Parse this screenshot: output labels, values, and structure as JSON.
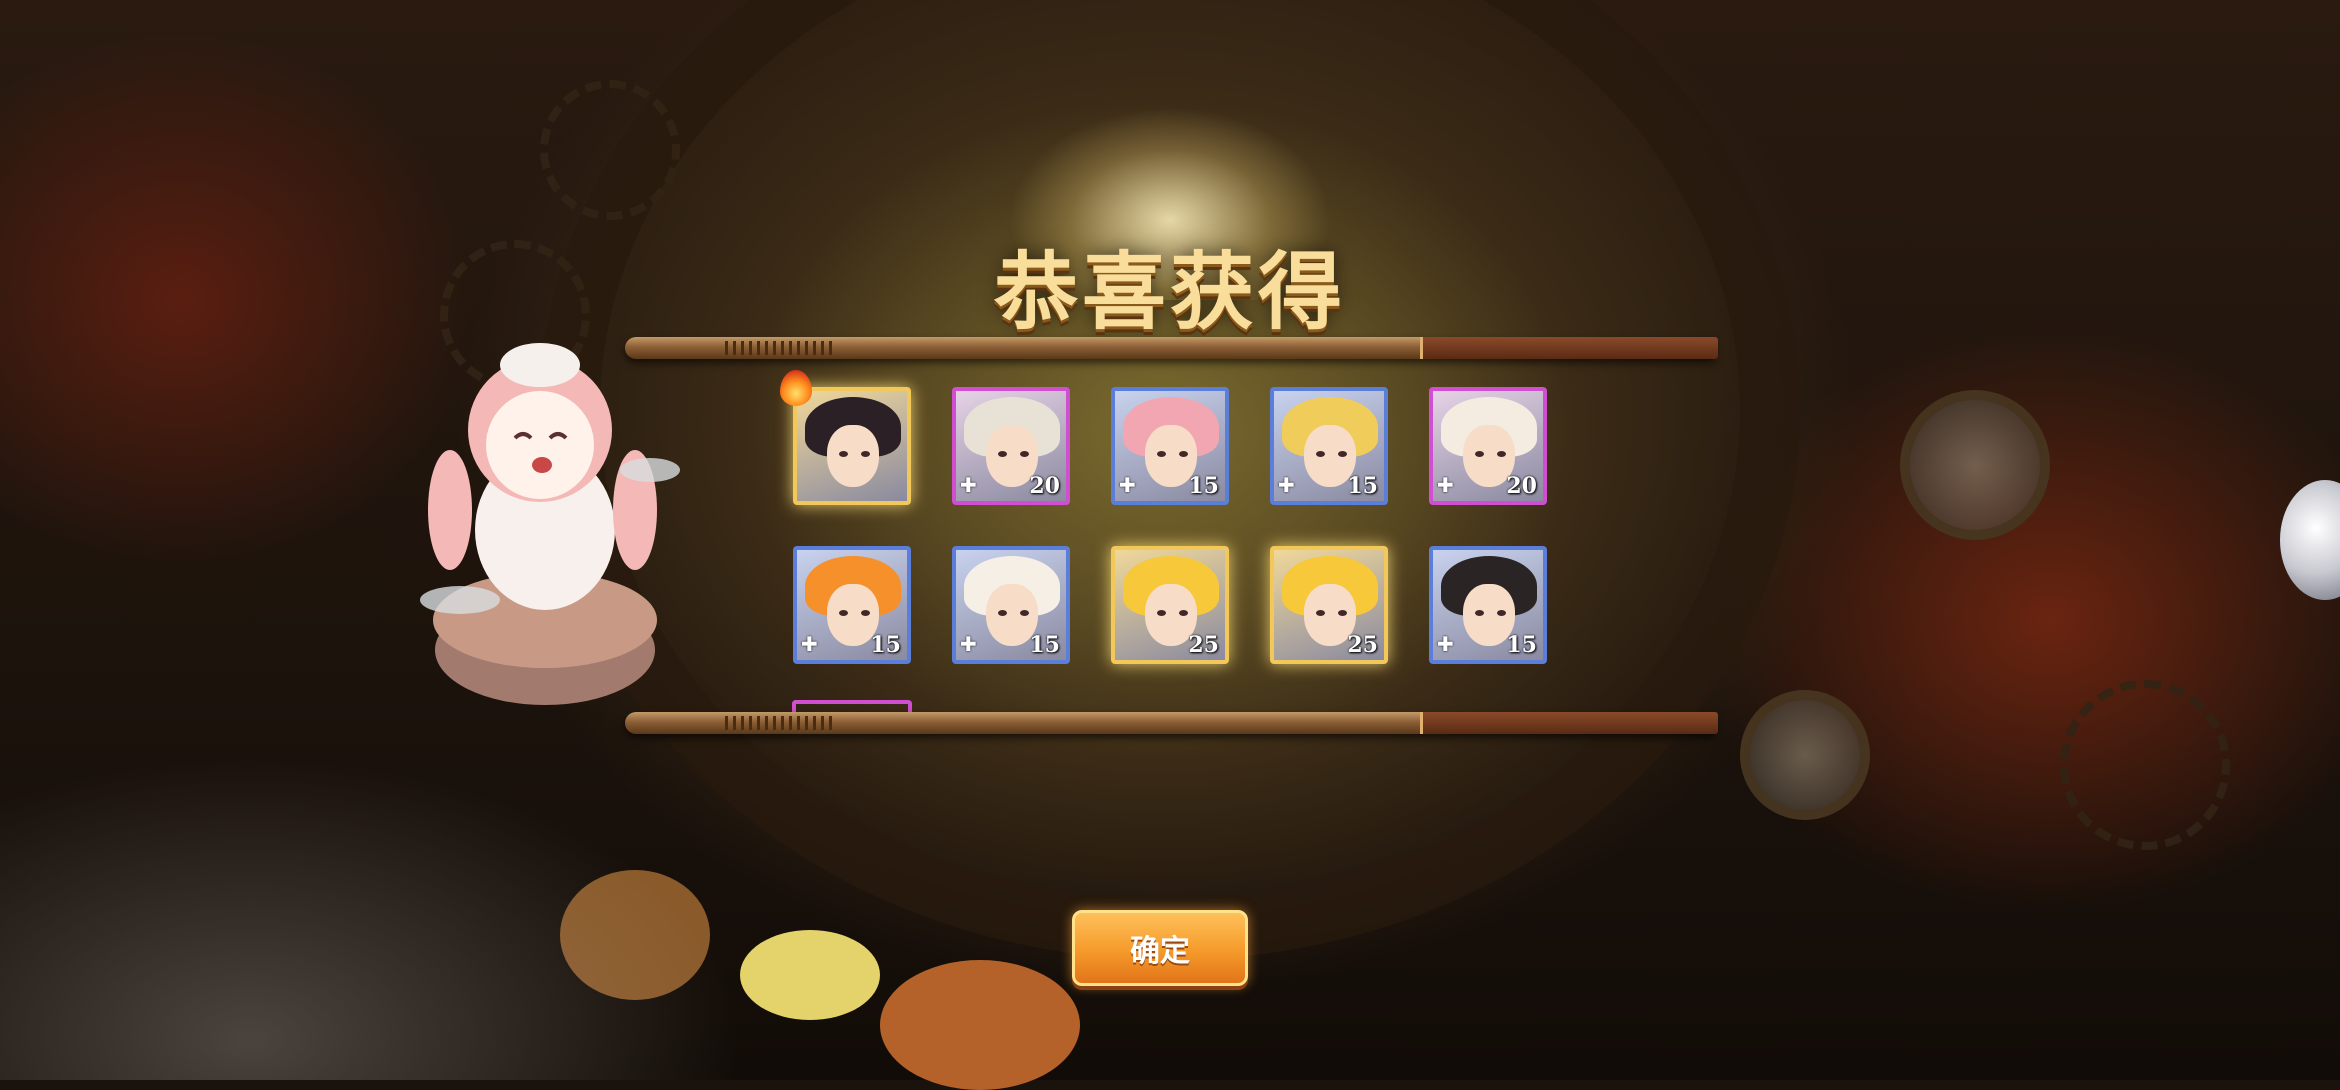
{
  "dialog": {
    "title": "恭喜获得",
    "confirm_label": "确定"
  },
  "rewards": [
    {
      "id": "card-1",
      "rarity": "gold",
      "count": "",
      "hot": true,
      "hair": "#2a2026",
      "shard": false
    },
    {
      "id": "card-2",
      "rarity": "purple",
      "count": "20",
      "hair": "#e8e2d6",
      "shard": true
    },
    {
      "id": "card-3",
      "rarity": "blue",
      "count": "15",
      "hair": "#f2a6b2",
      "shard": true
    },
    {
      "id": "card-4",
      "rarity": "blue",
      "count": "15",
      "hair": "#f0cc5a",
      "shard": true
    },
    {
      "id": "card-5",
      "rarity": "purple",
      "count": "20",
      "hair": "#f4ece0",
      "shard": true
    },
    {
      "id": "card-6",
      "rarity": "blue",
      "count": "15",
      "hair": "#f5902a",
      "shard": true
    },
    {
      "id": "card-7",
      "rarity": "blue",
      "count": "15",
      "hair": "#f6efe6",
      "shard": true
    },
    {
      "id": "card-8",
      "rarity": "gold",
      "count": "25",
      "hair": "#f7c83a",
      "shard": false
    },
    {
      "id": "card-9",
      "rarity": "gold",
      "count": "25",
      "hair": "#f7c83a",
      "shard": false
    },
    {
      "id": "card-10",
      "rarity": "blue",
      "count": "15",
      "hair": "#2a2424",
      "shard": true
    }
  ],
  "colors": {
    "gold_frame": "#f2c85a",
    "purple_frame": "#d04ed0",
    "blue_frame": "#5b7ed8",
    "button": "#f59a2a",
    "title_text": "#f9dd9a"
  },
  "icons": {
    "hot": "fire-icon",
    "shard": "puzzle-piece-icon"
  }
}
